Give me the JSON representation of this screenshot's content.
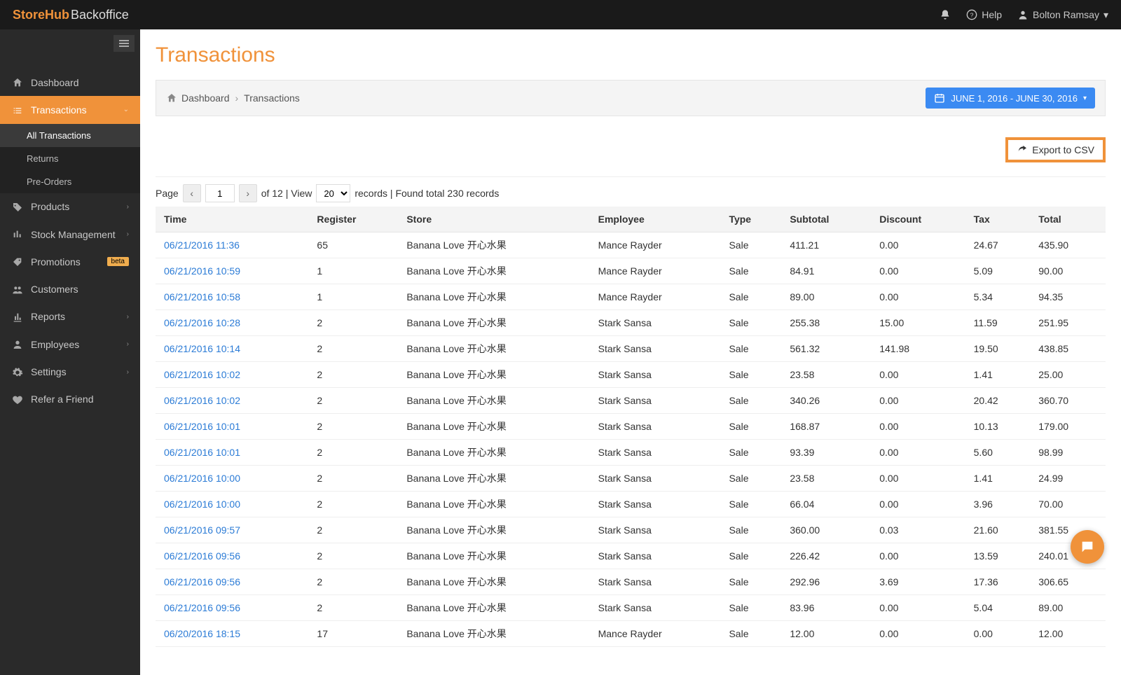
{
  "header": {
    "brand_bold": "StoreHub",
    "brand_light": " Backoffice",
    "help_label": "Help",
    "user_name": "Bolton Ramsay"
  },
  "sidebar": {
    "items": [
      {
        "icon": "home",
        "label": "Dashboard"
      },
      {
        "icon": "list",
        "label": "Transactions",
        "active": true,
        "expandable": true
      },
      {
        "icon": "tag",
        "label": "Products",
        "expandable": true
      },
      {
        "icon": "bars",
        "label": "Stock Management",
        "expandable": true
      },
      {
        "icon": "pricetag",
        "label": "Promotions",
        "badge": "beta"
      },
      {
        "icon": "users",
        "label": "Customers"
      },
      {
        "icon": "chart",
        "label": "Reports",
        "expandable": true
      },
      {
        "icon": "person",
        "label": "Employees",
        "expandable": true
      },
      {
        "icon": "gear",
        "label": "Settings",
        "expandable": true
      },
      {
        "icon": "heart",
        "label": "Refer a Friend"
      }
    ],
    "sub_items": [
      {
        "label": "All Transactions",
        "active": true
      },
      {
        "label": "Returns"
      },
      {
        "label": "Pre-Orders"
      }
    ]
  },
  "page": {
    "title": "Transactions",
    "breadcrumb": [
      "Dashboard",
      "Transactions"
    ],
    "breadcrumb_sep": "›",
    "date_range_label": "JUNE 1, 2016 - JUNE 30, 2016",
    "export_label": "Export to CSV"
  },
  "pager": {
    "page_label": "Page",
    "current_page": "1",
    "total_pages_text": "of 12 | View",
    "per_page": "20",
    "records_text": "records | Found total 230 records"
  },
  "table": {
    "columns": [
      "Time",
      "Register",
      "Store",
      "Employee",
      "Type",
      "Subtotal",
      "Discount",
      "Tax",
      "Total"
    ],
    "rows": [
      {
        "time": "06/21/2016 11:36",
        "register": "65",
        "store": "Banana Love 开心水果",
        "employee": "Mance Rayder",
        "type": "Sale",
        "subtotal": "411.21",
        "discount": "0.00",
        "tax": "24.67",
        "total": "435.90"
      },
      {
        "time": "06/21/2016 10:59",
        "register": "1",
        "store": "Banana Love 开心水果",
        "employee": "Mance Rayder",
        "type": "Sale",
        "subtotal": "84.91",
        "discount": "0.00",
        "tax": "5.09",
        "total": "90.00"
      },
      {
        "time": "06/21/2016 10:58",
        "register": "1",
        "store": "Banana Love 开心水果",
        "employee": "Mance Rayder",
        "type": "Sale",
        "subtotal": "89.00",
        "discount": "0.00",
        "tax": "5.34",
        "total": "94.35"
      },
      {
        "time": "06/21/2016 10:28",
        "register": "2",
        "store": "Banana Love 开心水果",
        "employee": "Stark Sansa",
        "type": "Sale",
        "subtotal": "255.38",
        "discount": "15.00",
        "tax": "11.59",
        "total": "251.95"
      },
      {
        "time": "06/21/2016 10:14",
        "register": "2",
        "store": "Banana Love 开心水果",
        "employee": "Stark Sansa",
        "type": "Sale",
        "subtotal": "561.32",
        "discount": "141.98",
        "tax": "19.50",
        "total": "438.85"
      },
      {
        "time": "06/21/2016 10:02",
        "register": "2",
        "store": "Banana Love 开心水果",
        "employee": "Stark Sansa",
        "type": "Sale",
        "subtotal": "23.58",
        "discount": "0.00",
        "tax": "1.41",
        "total": "25.00"
      },
      {
        "time": "06/21/2016 10:02",
        "register": "2",
        "store": "Banana Love 开心水果",
        "employee": "Stark Sansa",
        "type": "Sale",
        "subtotal": "340.26",
        "discount": "0.00",
        "tax": "20.42",
        "total": "360.70"
      },
      {
        "time": "06/21/2016 10:01",
        "register": "2",
        "store": "Banana Love 开心水果",
        "employee": "Stark Sansa",
        "type": "Sale",
        "subtotal": "168.87",
        "discount": "0.00",
        "tax": "10.13",
        "total": "179.00"
      },
      {
        "time": "06/21/2016 10:01",
        "register": "2",
        "store": "Banana Love 开心水果",
        "employee": "Stark Sansa",
        "type": "Sale",
        "subtotal": "93.39",
        "discount": "0.00",
        "tax": "5.60",
        "total": "98.99"
      },
      {
        "time": "06/21/2016 10:00",
        "register": "2",
        "store": "Banana Love 开心水果",
        "employee": "Stark Sansa",
        "type": "Sale",
        "subtotal": "23.58",
        "discount": "0.00",
        "tax": "1.41",
        "total": "24.99"
      },
      {
        "time": "06/21/2016 10:00",
        "register": "2",
        "store": "Banana Love 开心水果",
        "employee": "Stark Sansa",
        "type": "Sale",
        "subtotal": "66.04",
        "discount": "0.00",
        "tax": "3.96",
        "total": "70.00"
      },
      {
        "time": "06/21/2016 09:57",
        "register": "2",
        "store": "Banana Love 开心水果",
        "employee": "Stark Sansa",
        "type": "Sale",
        "subtotal": "360.00",
        "discount": "0.03",
        "tax": "21.60",
        "total": "381.55"
      },
      {
        "time": "06/21/2016 09:56",
        "register": "2",
        "store": "Banana Love 开心水果",
        "employee": "Stark Sansa",
        "type": "Sale",
        "subtotal": "226.42",
        "discount": "0.00",
        "tax": "13.59",
        "total": "240.01"
      },
      {
        "time": "06/21/2016 09:56",
        "register": "2",
        "store": "Banana Love 开心水果",
        "employee": "Stark Sansa",
        "type": "Sale",
        "subtotal": "292.96",
        "discount": "3.69",
        "tax": "17.36",
        "total": "306.65"
      },
      {
        "time": "06/21/2016 09:56",
        "register": "2",
        "store": "Banana Love 开心水果",
        "employee": "Stark Sansa",
        "type": "Sale",
        "subtotal": "83.96",
        "discount": "0.00",
        "tax": "5.04",
        "total": "89.00"
      },
      {
        "time": "06/20/2016 18:15",
        "register": "17",
        "store": "Banana Love 开心水果",
        "employee": "Mance Rayder",
        "type": "Sale",
        "subtotal": "12.00",
        "discount": "0.00",
        "tax": "0.00",
        "total": "12.00"
      }
    ]
  }
}
